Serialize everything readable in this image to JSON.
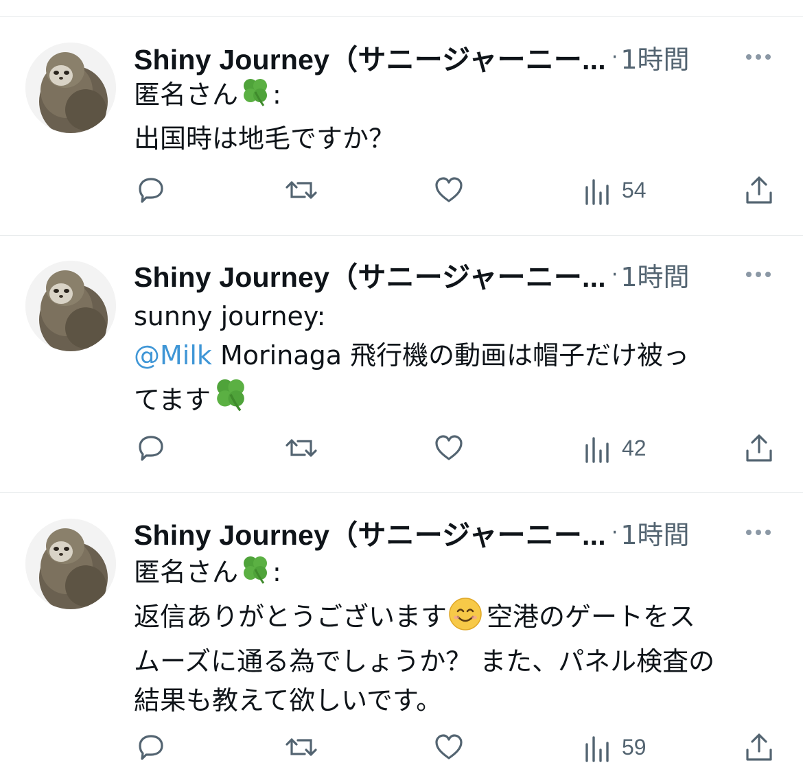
{
  "tweets": [
    {
      "author": "Shiny Journey（サニージャーニー...",
      "separator": "·",
      "time": "1時間",
      "quoted_author": "匿名さん",
      "quoted_suffix": ":",
      "text_line1": "出国時は地毛ですか？",
      "views": "54",
      "icons": [
        "reply-icon",
        "retweet-icon",
        "like-icon",
        "views-icon",
        "share-icon",
        "more-icon"
      ]
    },
    {
      "author": "Shiny Journey（サニージャーニー...",
      "separator": "·",
      "time": "1時間",
      "quoted_author": "sunny journey:",
      "mention": "@Milk",
      "text_rest": " Morinaga  飛行機の動画は帽子だけ被っ",
      "text_line2": "てます",
      "views": "42",
      "icons": [
        "reply-icon",
        "retweet-icon",
        "like-icon",
        "views-icon",
        "share-icon",
        "more-icon"
      ]
    },
    {
      "author": "Shiny Journey（サニージャーニー...",
      "separator": "·",
      "time": "1時間",
      "quoted_author": "匿名さん",
      "quoted_suffix": ":",
      "text_line1_a": "返信ありがとうございます",
      "text_line1_b": "空港のゲートをス",
      "text_line2": "ムーズに通る為でしょうか？ また、パネル検査の",
      "text_line3": "結果も教えて欲しいです。",
      "views": "59",
      "icons": [
        "reply-icon",
        "retweet-icon",
        "like-icon",
        "views-icon",
        "share-icon",
        "more-icon"
      ]
    }
  ],
  "colors": {
    "text": "#0f1419",
    "secondary": "#536471",
    "mention": "#3f96d6",
    "divider": "#e6e9eb"
  }
}
